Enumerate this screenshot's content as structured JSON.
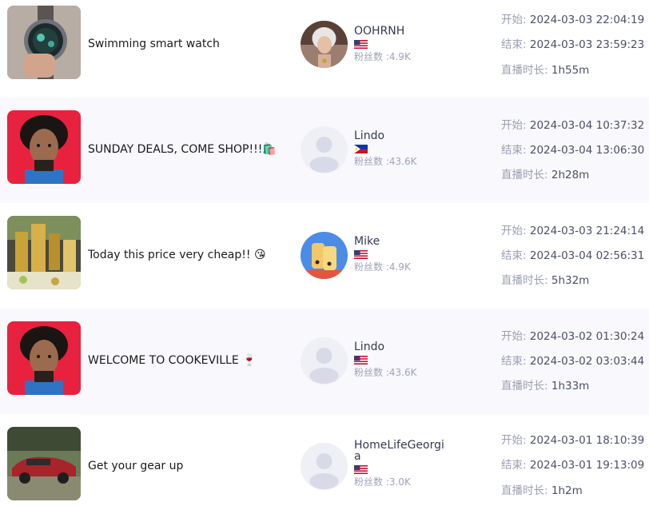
{
  "labels": {
    "start": "开始:",
    "end": "结束:",
    "duration": "直播时长:",
    "fans_prefix": "粉丝数 :"
  },
  "rows": [
    {
      "title": "Swimming smart watch",
      "thumbnail_icon": "smartwatch-photo",
      "anchor": {
        "name": "OOHRNH",
        "flag": "us-flag",
        "fans": "4.9K",
        "avatar_icon": "anchor-avatar-photo"
      },
      "start": "2024-03-03 22:04:19",
      "end": "2024-03-03 23:59:23",
      "duration": "1h55m"
    },
    {
      "title": "SUNDAY DEALS, COME SHOP!!!🛍️",
      "thumbnail_icon": "man-portrait",
      "anchor": {
        "name": "Lindo",
        "flag": "ph-flag",
        "fans": "43.6K",
        "avatar_icon": "default-avatar"
      },
      "start": "2024-03-04 10:37:32",
      "end": "2024-03-04 13:06:30",
      "duration": "2h28m"
    },
    {
      "title": "Today this price very cheap!! 😘",
      "thumbnail_icon": "gold-jewelry-photo",
      "anchor": {
        "name": "Mike",
        "flag": "us-flag",
        "fans": "4.9K",
        "avatar_icon": "bubble-tea-avatar"
      },
      "start": "2024-03-03 21:24:14",
      "end": "2024-03-04 02:56:31",
      "duration": "5h32m"
    },
    {
      "title": "WELCOME TO COOKEVILLE 🍷",
      "thumbnail_icon": "man-portrait",
      "anchor": {
        "name": "Lindo",
        "flag": "us-flag",
        "fans": "43.6K",
        "avatar_icon": "default-avatar"
      },
      "start": "2024-03-02 01:30:24",
      "end": "2024-03-02 03:03:44",
      "duration": "1h33m"
    },
    {
      "title": "Get your gear up",
      "thumbnail_icon": "red-car-photo",
      "anchor": {
        "name": "HomeLifeGeorgia",
        "flag": "us-flag",
        "fans": "3.0K",
        "avatar_icon": "default-avatar"
      },
      "start": "2024-03-01 18:10:39",
      "end": "2024-03-01 19:13:09",
      "duration": "1h2m"
    }
  ],
  "colors": {
    "alt_row_bg": "#f8f8fd",
    "label": "#9a9eb2",
    "value": "#4b5068",
    "fans": "#9fa3b8"
  }
}
